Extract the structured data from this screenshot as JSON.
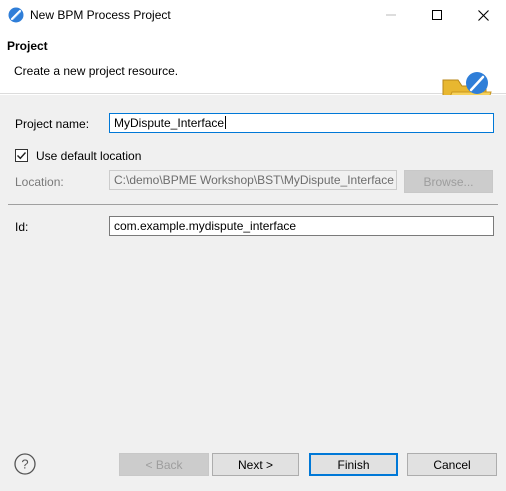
{
  "window": {
    "title": "New BPM Process Project",
    "app_icon": "bpm-logo-icon",
    "controls": [
      "minimize-icon",
      "maximize-icon",
      "close-icon"
    ]
  },
  "header": {
    "title": "Project",
    "description": "Create a new project resource.",
    "icon": "folder-wizard-icon"
  },
  "form": {
    "project_name_label": "Project name:",
    "project_name_value": "MyDispute_Interface",
    "use_default_location_label": "Use default location",
    "use_default_location_checked": true,
    "location_label": "Location:",
    "location_value": "C:\\demo\\BPME Workshop\\BST\\MyDispute_Interface",
    "browse_label": "Browse...",
    "id_label": "Id:",
    "id_value": "com.example.mydispute_interface"
  },
  "footer": {
    "help_icon": "help-icon",
    "back_label": "< Back",
    "next_label": "Next >",
    "finish_label": "Finish",
    "cancel_label": "Cancel"
  },
  "colors": {
    "accent": "#0078d7",
    "body_background": "#f0f0f0",
    "button_background": "#e1e1e1"
  }
}
